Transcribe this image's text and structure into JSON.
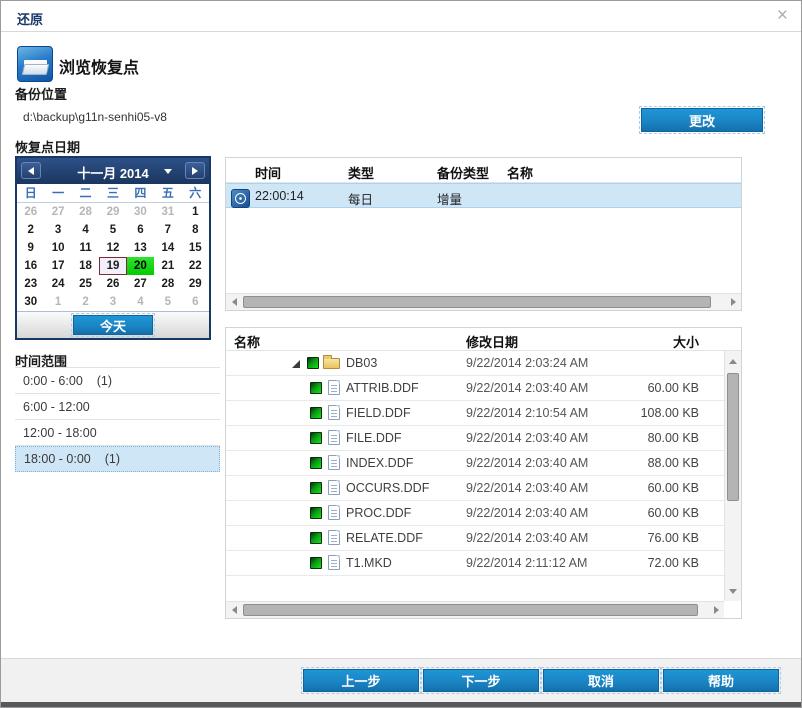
{
  "window": {
    "title": "还原"
  },
  "header": {
    "title": "浏览恢复点"
  },
  "backup_location": {
    "label": "备份位置",
    "path": "d:\\backup\\g11n-senhi05-v8",
    "change_button": "更改"
  },
  "recovery_point": {
    "label": "恢复点日期"
  },
  "calendar": {
    "month_label": "十一月 2014",
    "weekdays": [
      "日",
      "一",
      "二",
      "三",
      "四",
      "五",
      "六"
    ],
    "days": [
      {
        "d": "26",
        "muted": true
      },
      {
        "d": "27",
        "muted": true
      },
      {
        "d": "28",
        "muted": true
      },
      {
        "d": "29",
        "muted": true
      },
      {
        "d": "30",
        "muted": true
      },
      {
        "d": "31",
        "muted": true
      },
      {
        "d": "1"
      },
      {
        "d": "2"
      },
      {
        "d": "3"
      },
      {
        "d": "4"
      },
      {
        "d": "5"
      },
      {
        "d": "6"
      },
      {
        "d": "7"
      },
      {
        "d": "8"
      },
      {
        "d": "9"
      },
      {
        "d": "10"
      },
      {
        "d": "11"
      },
      {
        "d": "12"
      },
      {
        "d": "13"
      },
      {
        "d": "14"
      },
      {
        "d": "15"
      },
      {
        "d": "16"
      },
      {
        "d": "17"
      },
      {
        "d": "18"
      },
      {
        "d": "19",
        "state": "selected"
      },
      {
        "d": "20",
        "state": "today"
      },
      {
        "d": "21"
      },
      {
        "d": "22"
      },
      {
        "d": "23"
      },
      {
        "d": "24"
      },
      {
        "d": "25"
      },
      {
        "d": "26"
      },
      {
        "d": "27"
      },
      {
        "d": "28"
      },
      {
        "d": "29"
      },
      {
        "d": "30"
      },
      {
        "d": "1",
        "muted": true
      },
      {
        "d": "2",
        "muted": true
      },
      {
        "d": "3",
        "muted": true
      },
      {
        "d": "4",
        "muted": true
      },
      {
        "d": "5",
        "muted": true
      },
      {
        "d": "6",
        "muted": true
      }
    ],
    "selected_day": "19",
    "today_day": "20",
    "today_button": "今天"
  },
  "time_range": {
    "label": "时间范围",
    "items": [
      {
        "label": "0:00 - 6:00",
        "count": "(1)",
        "selected": false
      },
      {
        "label": "6:00 - 12:00",
        "count": "",
        "selected": false
      },
      {
        "label": "12:00 - 18:00",
        "count": "",
        "selected": false
      },
      {
        "label": "18:00 - 0:00",
        "count": "(1)",
        "selected": true
      }
    ]
  },
  "recovery_table": {
    "headers": {
      "time": "时间",
      "type": "类型",
      "backup_type": "备份类型",
      "name": "名称"
    },
    "rows": [
      {
        "time": "22:00:14",
        "type": "每日",
        "backup_type": "增量",
        "name": ""
      }
    ]
  },
  "file_table": {
    "headers": {
      "name": "名称",
      "modified": "修改日期",
      "size": "大小"
    },
    "rows": [
      {
        "name": "DB03",
        "kind": "folder",
        "modified": "9/22/2014 2:03:24 AM",
        "size": ""
      },
      {
        "name": "ATTRIB.DDF",
        "kind": "file",
        "modified": "9/22/2014 2:03:40 AM",
        "size": "60.00 KB"
      },
      {
        "name": "FIELD.DDF",
        "kind": "file",
        "modified": "9/22/2014 2:10:54 AM",
        "size": "108.00 KB"
      },
      {
        "name": "FILE.DDF",
        "kind": "file",
        "modified": "9/22/2014 2:03:40 AM",
        "size": "80.00 KB"
      },
      {
        "name": "INDEX.DDF",
        "kind": "file",
        "modified": "9/22/2014 2:03:40 AM",
        "size": "88.00 KB"
      },
      {
        "name": "OCCURS.DDF",
        "kind": "file",
        "modified": "9/22/2014 2:03:40 AM",
        "size": "60.00 KB"
      },
      {
        "name": "PROC.DDF",
        "kind": "file",
        "modified": "9/22/2014 2:03:40 AM",
        "size": "60.00 KB"
      },
      {
        "name": "RELATE.DDF",
        "kind": "file",
        "modified": "9/22/2014 2:03:40 AM",
        "size": "76.00 KB"
      },
      {
        "name": "T1.MKD",
        "kind": "file",
        "modified": "9/22/2014 2:11:12 AM",
        "size": "72.00 KB"
      }
    ]
  },
  "footer": {
    "buttons": [
      "上一步",
      "下一步",
      "取消",
      "帮助"
    ]
  },
  "colors": {
    "accent_blue": "#1b8dcc",
    "calendar_navy": "#173862",
    "today_green": "#00d400",
    "selection_blue": "#cfe6f7"
  }
}
